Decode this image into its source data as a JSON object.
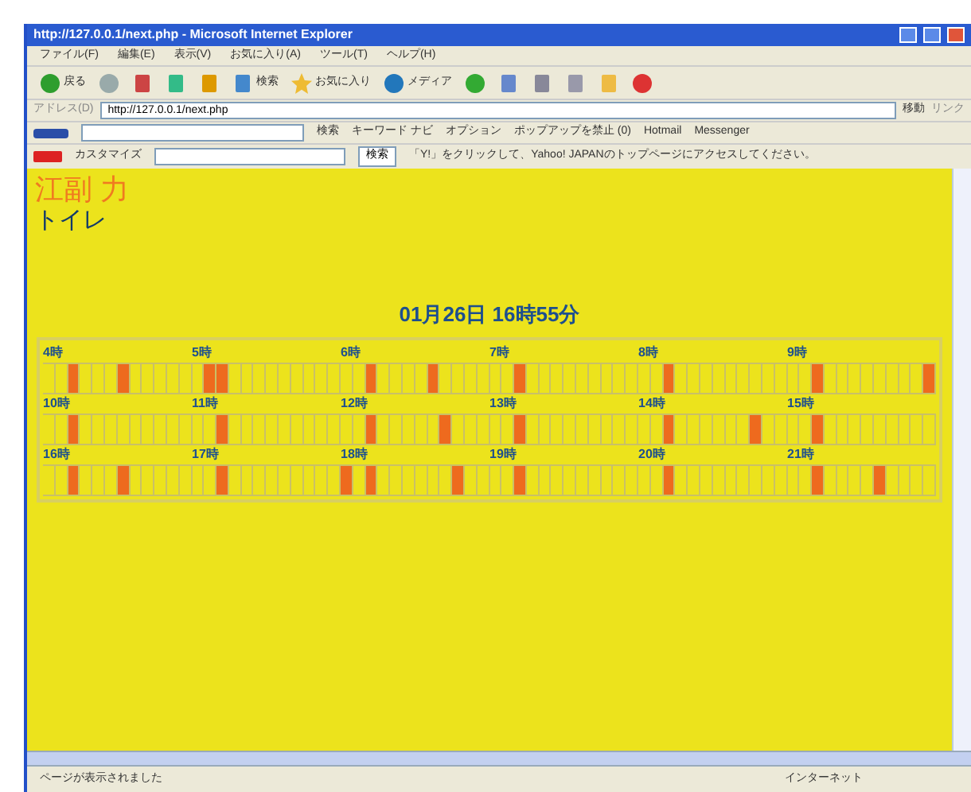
{
  "window": {
    "title": "http://127.0.0.1/next.php - Microsoft Internet Explorer"
  },
  "menu": [
    "ファイル(F)",
    "編集(E)",
    "表示(V)",
    "お気に入り(A)",
    "ツール(T)",
    "ヘルプ(H)"
  ],
  "toolbar": [
    {
      "kind": "back",
      "label": "戻る"
    },
    {
      "kind": "forward"
    },
    {
      "kind": "stop"
    },
    {
      "kind": "refresh"
    },
    {
      "kind": "home"
    },
    {
      "kind": "search",
      "label": "検索"
    },
    {
      "kind": "favorites",
      "label": "お気に入り"
    },
    {
      "kind": "media",
      "label": "メディア"
    },
    {
      "kind": "history"
    },
    {
      "kind": "mail"
    },
    {
      "kind": "print"
    },
    {
      "kind": "edit"
    },
    {
      "kind": "note"
    },
    {
      "kind": "stop-red"
    }
  ],
  "address": {
    "label": "アドレス(D)",
    "value": "http://127.0.0.1/next.php",
    "go": "移動",
    "links": "リンク"
  },
  "msn_bar": {
    "search": "検索",
    "keyword": "キーワード ナビ",
    "options": "オプション",
    "popup": "ポップアップを禁止 (0)",
    "hotmail": "Hotmail",
    "messenger": "Messenger"
  },
  "yahoo_bar": {
    "customize": "カスタマイズ",
    "search": "検索",
    "hint": "「Y!」をクリックして、Yahoo! JAPANのトップページにアクセスしてください。"
  },
  "page": {
    "name": "江副 力",
    "place": "トイレ",
    "datetime": "01月26日 16時55分",
    "hours": [
      {
        "label": "4時",
        "slots": [
          false,
          false,
          true,
          false,
          false,
          false,
          true,
          false,
          false,
          false,
          false,
          false
        ]
      },
      {
        "label": "5時",
        "slots": [
          false,
          true,
          true,
          false,
          false,
          false,
          false,
          false,
          false,
          false,
          false,
          false
        ]
      },
      {
        "label": "6時",
        "slots": [
          false,
          false,
          true,
          false,
          false,
          false,
          false,
          true,
          false,
          false,
          false,
          false
        ]
      },
      {
        "label": "7時",
        "slots": [
          false,
          false,
          true,
          false,
          false,
          false,
          false,
          false,
          false,
          false,
          false,
          false
        ]
      },
      {
        "label": "8時",
        "slots": [
          false,
          false,
          true,
          false,
          false,
          false,
          false,
          false,
          false,
          false,
          false,
          false
        ]
      },
      {
        "label": "9時",
        "slots": [
          false,
          false,
          true,
          false,
          false,
          false,
          false,
          false,
          false,
          false,
          false,
          true
        ]
      },
      {
        "label": "10時",
        "slots": [
          false,
          false,
          true,
          false,
          false,
          false,
          false,
          false,
          false,
          false,
          false,
          false
        ]
      },
      {
        "label": "11時",
        "slots": [
          false,
          false,
          true,
          false,
          false,
          false,
          false,
          false,
          false,
          false,
          false,
          false
        ]
      },
      {
        "label": "12時",
        "slots": [
          false,
          false,
          true,
          false,
          false,
          false,
          false,
          false,
          true,
          false,
          false,
          false
        ]
      },
      {
        "label": "13時",
        "slots": [
          false,
          false,
          true,
          false,
          false,
          false,
          false,
          false,
          false,
          false,
          false,
          false
        ]
      },
      {
        "label": "14時",
        "slots": [
          false,
          false,
          true,
          false,
          false,
          false,
          false,
          false,
          false,
          true,
          false,
          false
        ]
      },
      {
        "label": "15時",
        "slots": [
          false,
          false,
          true,
          false,
          false,
          false,
          false,
          false,
          false,
          false,
          false,
          false
        ]
      },
      {
        "label": "16時",
        "slots": [
          false,
          false,
          true,
          false,
          false,
          false,
          true,
          false,
          false,
          false,
          false,
          false
        ]
      },
      {
        "label": "17時",
        "slots": [
          false,
          false,
          true,
          false,
          false,
          false,
          false,
          false,
          false,
          false,
          false,
          false
        ]
      },
      {
        "label": "18時",
        "slots": [
          true,
          false,
          true,
          false,
          false,
          false,
          false,
          false,
          false,
          true,
          false,
          false
        ]
      },
      {
        "label": "19時",
        "slots": [
          false,
          false,
          true,
          false,
          false,
          false,
          false,
          false,
          false,
          false,
          false,
          false
        ]
      },
      {
        "label": "20時",
        "slots": [
          false,
          false,
          true,
          false,
          false,
          false,
          false,
          false,
          false,
          false,
          false,
          false
        ]
      },
      {
        "label": "21時",
        "slots": [
          false,
          false,
          true,
          false,
          false,
          false,
          false,
          true,
          false,
          false,
          false,
          false
        ]
      }
    ]
  },
  "status_bar": {
    "message": "ページが表示されました",
    "zone": "インターネット"
  }
}
